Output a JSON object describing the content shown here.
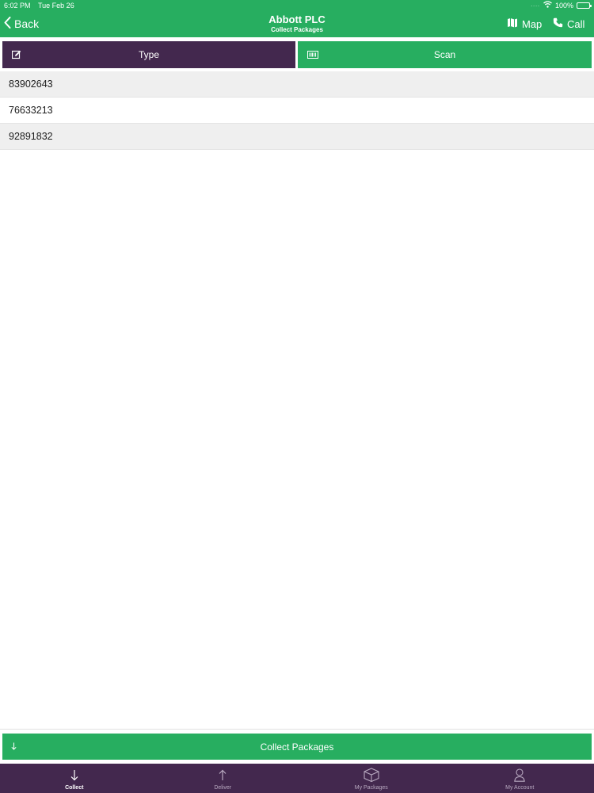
{
  "status_bar": {
    "time": "6:02 PM",
    "date": "Tue Feb 26",
    "signal": "....",
    "battery": "100%",
    "battery_level": 1.0
  },
  "nav": {
    "back_label": "Back",
    "title": "Abbott PLC",
    "subtitle": "Collect Packages",
    "map_label": "Map",
    "call_label": "Call"
  },
  "modes": {
    "type_label": "Type",
    "scan_label": "Scan"
  },
  "packages": [
    "83902643",
    "76633213",
    "92891832"
  ],
  "actions": {
    "collect_label": "Collect Packages"
  },
  "tabs": [
    {
      "label": "Collect",
      "icon": "arrow-down-icon",
      "active": true
    },
    {
      "label": "Deliver",
      "icon": "arrow-up-icon",
      "active": false
    },
    {
      "label": "My Packages",
      "icon": "box-icon",
      "active": false
    },
    {
      "label": "My Account",
      "icon": "user-icon",
      "active": false
    }
  ],
  "colors": {
    "brand_green": "#27ae60",
    "brand_purple": "#43284e",
    "row_shade": "#efefef"
  }
}
